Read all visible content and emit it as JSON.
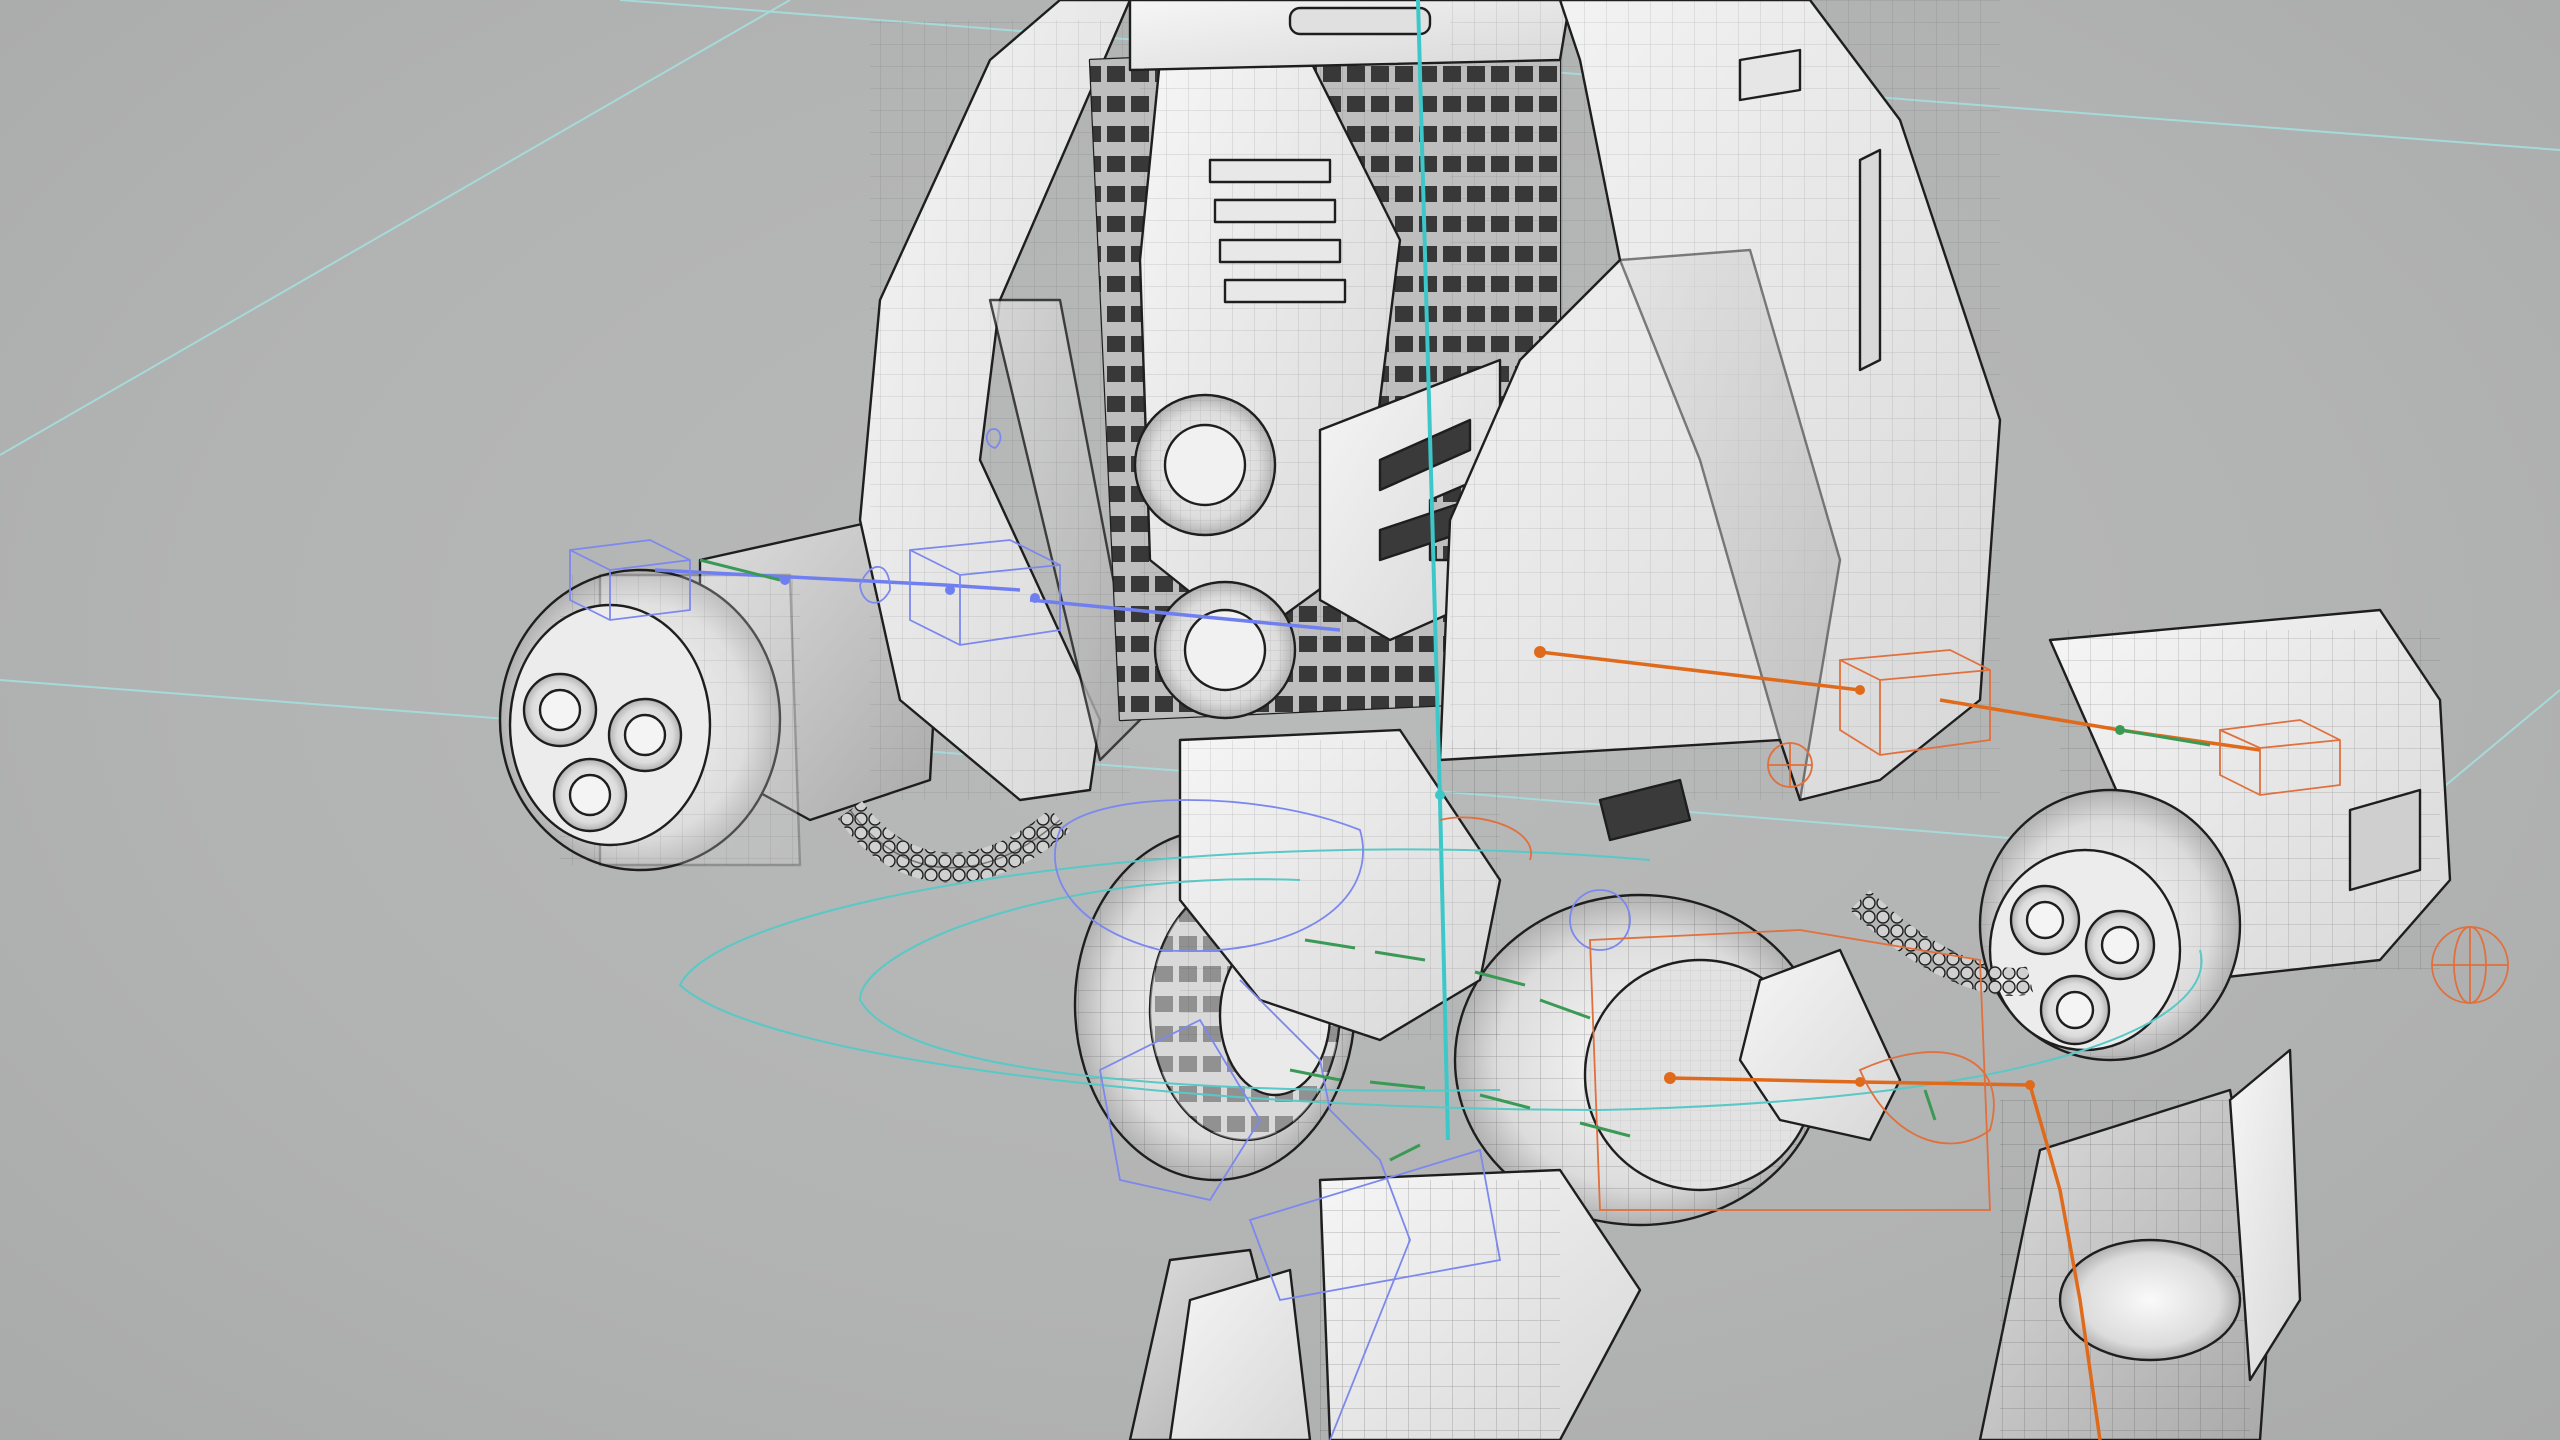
{
  "viewport": {
    "mode": "wireframe-on-shaded",
    "subject": "mech-model",
    "rig_colors": {
      "spine": "#3cc8c8",
      "left_side": "#6f7ff0",
      "right_side": "#e06a1c",
      "secondary": "#3a9a55",
      "ground_grid": "#a6dad8"
    },
    "background": "#b3b4b4"
  }
}
